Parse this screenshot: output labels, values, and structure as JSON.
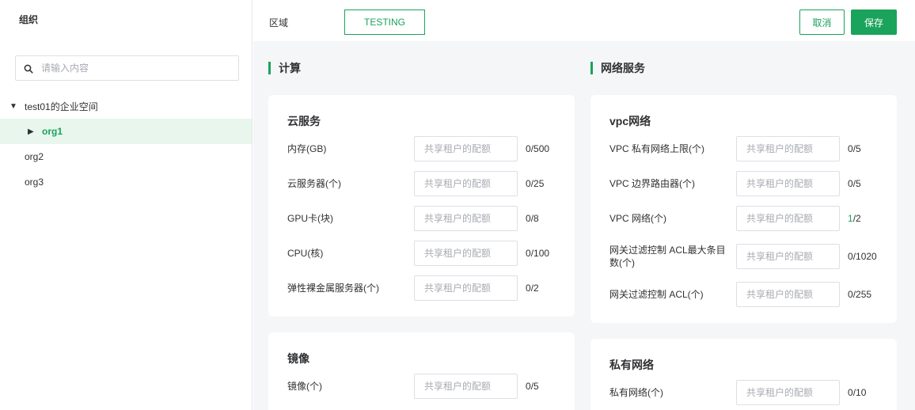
{
  "sidebar": {
    "title": "组织",
    "search_placeholder": "请输入内容",
    "tree": [
      {
        "label": "test01的企业空间",
        "arrow": "▼"
      },
      {
        "label": "org1",
        "arrow": "▶"
      },
      {
        "label": "org2",
        "arrow": ""
      },
      {
        "label": "org3",
        "arrow": ""
      }
    ]
  },
  "header": {
    "region_label": "区域",
    "region_value": "TESTING",
    "cancel_label": "取消",
    "save_label": "保存"
  },
  "compute": {
    "section_title": "计算",
    "cloud_service": {
      "title": "云服务",
      "rows": [
        {
          "label": "内存(GB)",
          "placeholder": "共享租户的配额",
          "used": "0",
          "total": "/500"
        },
        {
          "label": "云服务器(个)",
          "placeholder": "共享租户的配额",
          "used": "0",
          "total": "/25"
        },
        {
          "label": "GPU卡(块)",
          "placeholder": "共享租户的配额",
          "used": "0",
          "total": "/8"
        },
        {
          "label": "CPU(核)",
          "placeholder": "共享租户的配额",
          "used": "0",
          "total": "/100"
        },
        {
          "label": "弹性裸金属服务器(个)",
          "placeholder": "共享租户的配额",
          "used": "0",
          "total": "/2"
        }
      ]
    },
    "image": {
      "title": "镜像",
      "rows": [
        {
          "label": "镜像(个)",
          "placeholder": "共享租户的配额",
          "used": "0",
          "total": "/5"
        }
      ]
    }
  },
  "network": {
    "section_title": "网络服务",
    "vpc": {
      "title": "vpc网络",
      "rows": [
        {
          "label": "VPC 私有网络上限(个)",
          "placeholder": "共享租户的配额",
          "used": "0",
          "total": "/5"
        },
        {
          "label": "VPC 边界路由器(个)",
          "placeholder": "共享租户的配额",
          "used": "0",
          "total": "/5"
        },
        {
          "label": "VPC 网络(个)",
          "placeholder": "共享租户的配额",
          "used": "1",
          "total": "/2"
        },
        {
          "label": "网关过滤控制 ACL最大条目数(个)",
          "placeholder": "共享租户的配额",
          "used": "0",
          "total": "/1020"
        },
        {
          "label": "网关过滤控制 ACL(个)",
          "placeholder": "共享租户的配额",
          "used": "0",
          "total": "/255"
        }
      ]
    },
    "private_net": {
      "title": "私有网络",
      "rows": [
        {
          "label": "私有网络(个)",
          "placeholder": "共享租户的配额",
          "used": "0",
          "total": "/10"
        }
      ]
    }
  },
  "colors": {
    "accent": "#1aa35a",
    "active_bg": "#e8f6ee",
    "page_bg": "#f5f6f7"
  },
  "icons": {
    "search": "search-icon"
  }
}
